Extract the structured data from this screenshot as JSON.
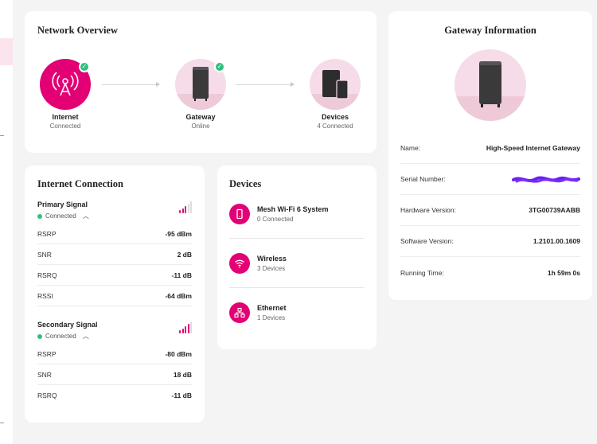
{
  "network_overview": {
    "title": "Network Overview",
    "nodes": [
      {
        "name": "Internet",
        "status": "Connected"
      },
      {
        "name": "Gateway",
        "status": "Online"
      },
      {
        "name": "Devices",
        "status": "4 Connected"
      }
    ]
  },
  "internet_connection": {
    "title": "Internet Connection",
    "primary": {
      "name": "Primary Signal",
      "status": "Connected",
      "signal_bars_lit": 3,
      "signal_bars_total": 5,
      "rows": [
        {
          "label": "RSRP",
          "value": "-95 dBm"
        },
        {
          "label": "SNR",
          "value": "2 dB"
        },
        {
          "label": "RSRQ",
          "value": "-11 dB"
        },
        {
          "label": "RSSI",
          "value": "-64 dBm"
        }
      ]
    },
    "secondary": {
      "name": "Secondary Signal",
      "status": "Connected",
      "signal_bars_lit": 4,
      "signal_bars_total": 5,
      "rows": [
        {
          "label": "RSRP",
          "value": "-80 dBm"
        },
        {
          "label": "SNR",
          "value": "18 dB"
        },
        {
          "label": "RSRQ",
          "value": "-11 dB"
        }
      ]
    }
  },
  "devices": {
    "title": "Devices",
    "items": [
      {
        "name": "Mesh Wi-Fi 6 System",
        "sub": "0 Connected",
        "icon": "phone-icon"
      },
      {
        "name": "Wireless",
        "sub": "3 Devices",
        "icon": "wifi-icon"
      },
      {
        "name": "Ethernet",
        "sub": "1 Devices",
        "icon": "ethernet-icon"
      }
    ]
  },
  "gateway_info": {
    "title": "Gateway Information",
    "rows": [
      {
        "label": "Name:",
        "value": "High-Speed Internet Gateway"
      },
      {
        "label": "Serial Number:",
        "value": ""
      },
      {
        "label": "Hardware Version:",
        "value": "3TG00739AABB"
      },
      {
        "label": "Software Version:",
        "value": "1.2101.00.1609"
      },
      {
        "label": "Running Time:",
        "value": "1h 59m 0s"
      }
    ]
  },
  "colors": {
    "accent": "#e20074",
    "success": "#2ec27e",
    "redaction": "#6b1ff0"
  }
}
